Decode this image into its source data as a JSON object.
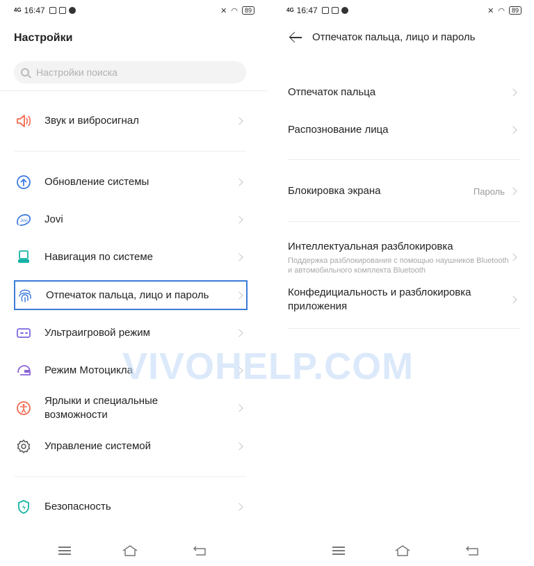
{
  "status": {
    "signal": "4G",
    "time": "16:47",
    "battery": "89"
  },
  "left": {
    "title": "Настройки",
    "search_placeholder": "Настройки поиска",
    "items": [
      {
        "label": "Звук и вибросигнал",
        "icon": "speaker-icon",
        "color": "#f0694e"
      },
      {
        "label": "Обновление системы",
        "icon": "update-arrow-icon",
        "color": "#3d7be0"
      },
      {
        "label": "Jovi",
        "icon": "jovi-icon",
        "color": "#3d7be0"
      },
      {
        "label": "Навигация по системе",
        "icon": "navigation-icon",
        "color": "#14b3a4"
      },
      {
        "label": "Отпечаток пальца, лицо и пароль",
        "icon": "fingerprint-icon",
        "color": "#3d7be0"
      },
      {
        "label": "Ультраигровой режим",
        "icon": "gamepad-icon",
        "color": "#7b66e0"
      },
      {
        "label": "Режим Мотоцикла",
        "icon": "helmet-icon",
        "color": "#8a63d8"
      },
      {
        "label": "Ярлыки и специальные возможности",
        "icon": "accessibility-icon",
        "color": "#f0694e"
      },
      {
        "label": "Управление системой",
        "icon": "gear-icon",
        "color": "#555555"
      },
      {
        "label": "Безопасность",
        "icon": "shield-icon",
        "color": "#14b3a4"
      }
    ]
  },
  "right": {
    "title": "Отпечаток пальца, лицо и пароль",
    "items": [
      {
        "label": "Отпечаток пальца"
      },
      {
        "label": "Распознование лица"
      },
      {
        "label": "Блокировка экрана",
        "value": "Пароль"
      },
      {
        "label": "Интеллектуальная разблокировка",
        "sub": "Поддержка разблокирования с помощью наушников Bluetooth и автомобильного комплекта Bluetooth"
      },
      {
        "label": "Конфедициальность и разблокировка приложения"
      }
    ]
  },
  "watermark": "VIVOHELP.COM",
  "colors": {
    "highlight": "#3b7bd8",
    "accent_blue": "#3d7be0",
    "accent_teal": "#14b3a4"
  }
}
